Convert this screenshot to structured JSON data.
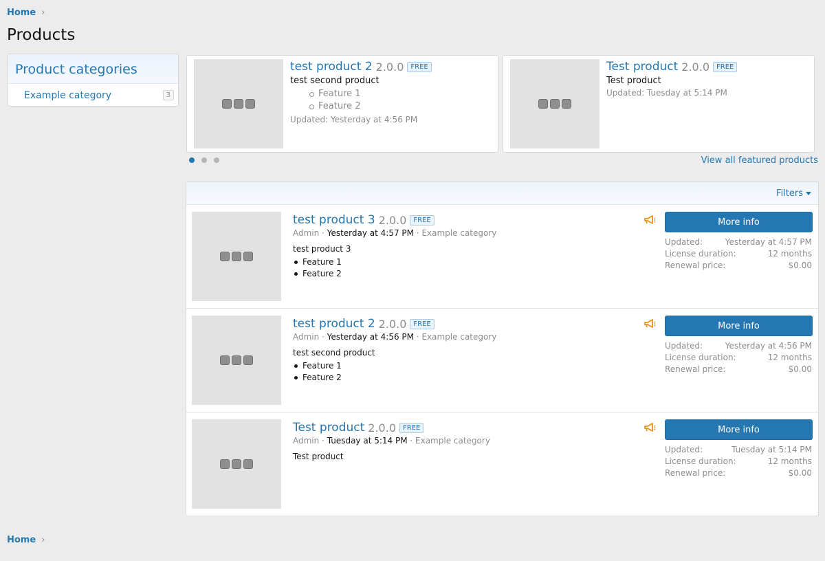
{
  "breadcrumb": {
    "home": "Home",
    "chevron": "›"
  },
  "page_title": "Products",
  "sidebar": {
    "title": "Product categories",
    "items": [
      {
        "label": "Example category",
        "count": "3"
      }
    ]
  },
  "featured": [
    {
      "name": "test product 2",
      "version": "2.0.0",
      "badge": "FREE",
      "description": "test second product",
      "features": [
        "Feature 1",
        "Feature 2"
      ],
      "updated": "Updated: Yesterday at 4:56 PM"
    },
    {
      "name": "Test product",
      "version": "2.0.0",
      "badge": "FREE",
      "description": "Test product",
      "features": [],
      "updated": "Updated: Tuesday at 5:14 PM"
    }
  ],
  "carousel": {
    "pages": 3,
    "active": 0
  },
  "view_all_featured": "View all featured products",
  "filters_label": "Filters",
  "stat_labels": {
    "updated": "Updated:",
    "license": "License duration:",
    "renewal": "Renewal price:"
  },
  "button_label": "More info",
  "products": [
    {
      "name": "test product 3",
      "version": "2.0.0",
      "badge": "FREE",
      "author": "Admin",
      "date": "Yesterday at 4:57 PM",
      "category": "Example category",
      "description": "test product 3",
      "features": [
        "Feature 1",
        "Feature 2"
      ],
      "updated": "Yesterday at 4:57 PM",
      "license": "12 months",
      "renewal": "$0.00"
    },
    {
      "name": "test product 2",
      "version": "2.0.0",
      "badge": "FREE",
      "author": "Admin",
      "date": "Yesterday at 4:56 PM",
      "category": "Example category",
      "description": "test second product",
      "features": [
        "Feature 1",
        "Feature 2"
      ],
      "updated": "Yesterday at 4:56 PM",
      "license": "12 months",
      "renewal": "$0.00"
    },
    {
      "name": "Test product",
      "version": "2.0.0",
      "badge": "FREE",
      "author": "Admin",
      "date": "Tuesday at 5:14 PM",
      "category": "Example category",
      "description": "Test product",
      "features": [],
      "updated": "Tuesday at 5:14 PM",
      "license": "12 months",
      "renewal": "$0.00"
    }
  ],
  "icons": {
    "thumbnail": "placeholder-icon",
    "featured_flag": "megaphone-icon",
    "filter_caret": "caret-down-icon"
  },
  "colors": {
    "accent": "#2577b1",
    "flag": "#e8911b",
    "background": "#ececec"
  }
}
